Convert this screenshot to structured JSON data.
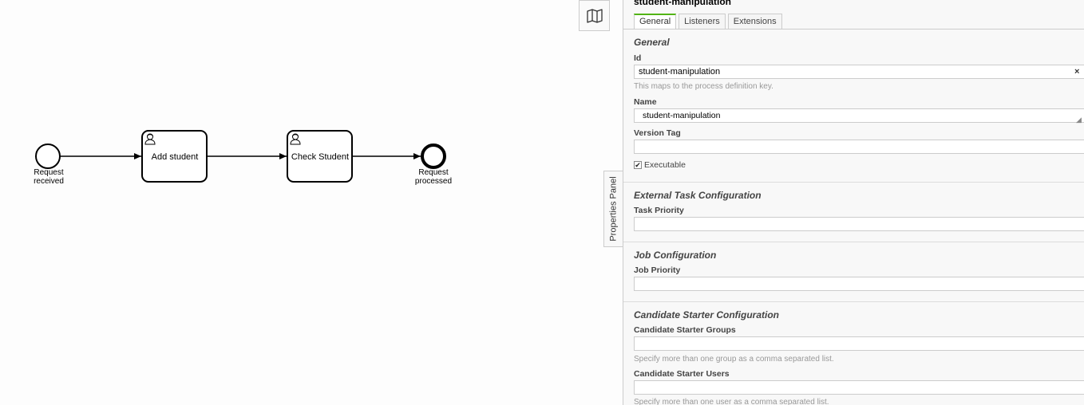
{
  "diagram": {
    "start_event_label_line1": "Request",
    "start_event_label_line2": "received",
    "task1_label": "Add student",
    "task2_label": "Check Student",
    "end_event_label_line1": "Request",
    "end_event_label_line2": "processed",
    "task_icon": "user-icon"
  },
  "minimap": {
    "icon": "map-icon"
  },
  "panel_toggle": {
    "label": "Properties Panel"
  },
  "panel": {
    "title": "student-manipulation",
    "tabs": [
      {
        "label": "General",
        "active": true
      },
      {
        "label": "Listeners",
        "active": false
      },
      {
        "label": "Extensions",
        "active": false
      }
    ],
    "general": {
      "section_title": "General",
      "id_label": "Id",
      "id_value": "student-manipulation",
      "id_clear": "×",
      "id_hint": "This maps to the process definition key.",
      "name_label": "Name",
      "name_value": "student-manipulation",
      "version_label": "Version Tag",
      "version_value": "",
      "executable_label": "Executable",
      "executable_checked": true
    },
    "external_task": {
      "section_title": "External Task Configuration",
      "priority_label": "Task Priority",
      "priority_value": ""
    },
    "job": {
      "section_title": "Job Configuration",
      "priority_label": "Job Priority",
      "priority_value": ""
    },
    "candidate": {
      "section_title": "Candidate Starter Configuration",
      "groups_label": "Candidate Starter Groups",
      "groups_value": "",
      "groups_hint": "Specify more than one group as a comma separated list.",
      "users_label": "Candidate Starter Users",
      "users_value": "",
      "users_hint": "Specify more than one user as a comma separated list."
    }
  },
  "colors": {
    "active_tab_accent": "#52b415",
    "panel_bg": "#f8f8f8"
  }
}
